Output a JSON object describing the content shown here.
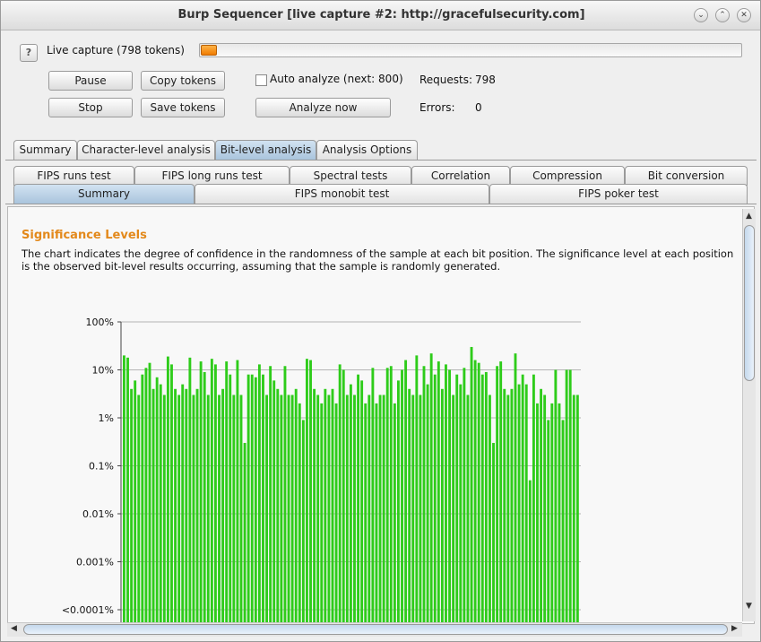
{
  "window": {
    "title": "Burp Sequencer [live capture #2: http://gracefulsecurity.com]",
    "controls": [
      "minimize-icon",
      "maximize-icon",
      "close-icon"
    ]
  },
  "capture": {
    "help": "?",
    "label": "Live capture (798 tokens)",
    "progress_fraction": 0.03
  },
  "buttons": {
    "pause": "Pause",
    "copy_tokens": "Copy tokens",
    "stop": "Stop",
    "save_tokens": "Save tokens",
    "analyze_now": "Analyze now"
  },
  "auto_analyze": {
    "label": "Auto analyze (next: 800)",
    "checked": false
  },
  "stats": {
    "requests_label": "Requests:",
    "requests_value": "798",
    "errors_label": "Errors:",
    "errors_value": "0"
  },
  "main_tabs": [
    "Summary",
    "Character-level analysis",
    "Bit-level analysis",
    "Analysis Options"
  ],
  "sub_tabs_row1": [
    "FIPS runs test",
    "FIPS long runs test",
    "Spectral tests",
    "Correlation",
    "Compression",
    "Bit conversion"
  ],
  "sub_tabs_row2": [
    "Summary",
    "FIPS monobit test",
    "FIPS poker test"
  ],
  "content": {
    "heading": "Significance Levels",
    "description": "The chart indicates the degree of confidence in the randomness of the sample at each bit position. The significance level at each position is the observed bit-level results occurring, assuming that the sample is randomly generated."
  },
  "colors": {
    "bar": "#2ecc1a",
    "heading": "#e3891b",
    "selected_tab": "#b7cfe6"
  },
  "chart_data": {
    "type": "bar",
    "y_scale": "log",
    "y_ticks": [
      "100%",
      "10%",
      "1%",
      "0.1%",
      "0.01%",
      "0.001%",
      "<0.0001%"
    ],
    "ylim_percent": [
      0.0001,
      100
    ],
    "values_percent": [
      20,
      18,
      4,
      6,
      3,
      8,
      11,
      14,
      4,
      7,
      5,
      3,
      19,
      13,
      4,
      3,
      5,
      4,
      18,
      3,
      4,
      15,
      9,
      3,
      17,
      13,
      3,
      4,
      15,
      8,
      3,
      16,
      3,
      0.3,
      8,
      8,
      7,
      13,
      8,
      3,
      12,
      6,
      4,
      3,
      12,
      3,
      3,
      4,
      2,
      0.9,
      17,
      16,
      4,
      3,
      2,
      4,
      3,
      4,
      2,
      13,
      10,
      3,
      5,
      3,
      8,
      6,
      2,
      3,
      11,
      2,
      3,
      3,
      11,
      12,
      2,
      6,
      10,
      16,
      4,
      3,
      20,
      3,
      12,
      5,
      22,
      8,
      15,
      4,
      13,
      10,
      3,
      8,
      5,
      11,
      3,
      30,
      16,
      14,
      8,
      9,
      3,
      0.3,
      12,
      15,
      4,
      3,
      4,
      22,
      5,
      8,
      5,
      0.05,
      8,
      2,
      4,
      3,
      0.9,
      2,
      10,
      2,
      0.9,
      10,
      10,
      3,
      3
    ]
  }
}
